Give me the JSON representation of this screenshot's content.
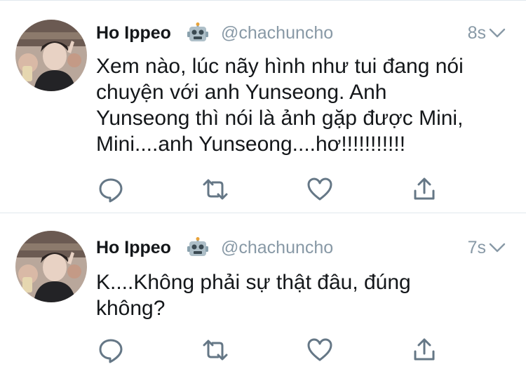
{
  "colors": {
    "text": "#14171a",
    "muted": "#8899a6",
    "divider": "#e1e8ed"
  },
  "tweets": [
    {
      "display_name": "Ho Ippeo",
      "badge_icon": "robot-emoji-icon",
      "handle": "@chachuncho",
      "time": "8s",
      "text": "Xem nào, lúc nãy hình như tui đang nói\nchuyện với anh Yunseong. Anh\nYunseong thì nói là ảnh gặp được Mini,\nMini....anh Yunseong....hơ!!!!!!!!!!!",
      "actions": [
        "reply-icon",
        "retweet-icon",
        "like-icon",
        "share-icon"
      ]
    },
    {
      "display_name": "Ho Ippeo",
      "badge_icon": "robot-emoji-icon",
      "handle": "@chachuncho",
      "time": "7s",
      "text": "K....Không phải sự thật đâu, đúng\nkhông?",
      "actions": [
        "reply-icon",
        "retweet-icon",
        "like-icon",
        "share-icon"
      ]
    }
  ]
}
